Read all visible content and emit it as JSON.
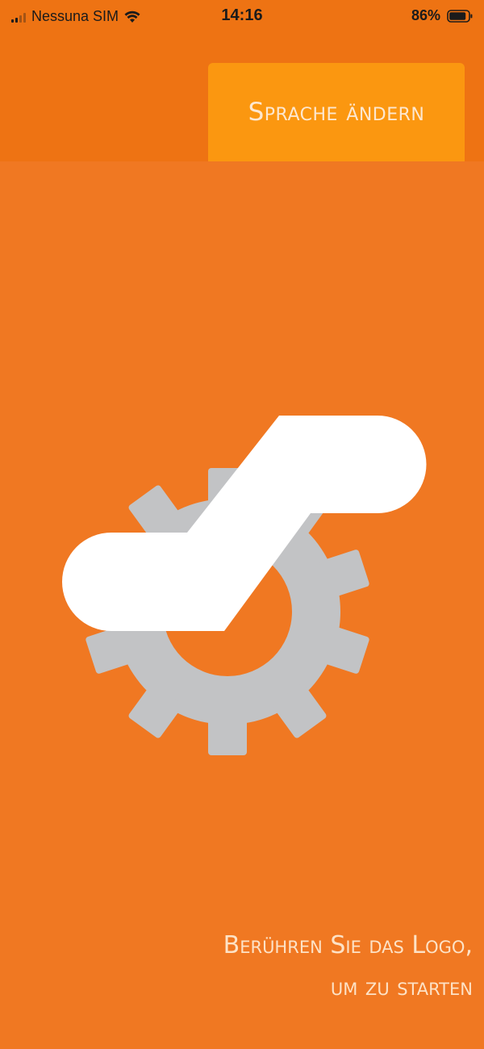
{
  "status_bar": {
    "carrier": "Nessuna SIM",
    "time": "14:16",
    "battery": "86%",
    "icons": [
      "signal-icon",
      "wifi-icon",
      "battery-icon"
    ]
  },
  "header": {
    "change_language_label": "Sprache ändern"
  },
  "logo": {
    "icon": "gear-logo-icon"
  },
  "hint": {
    "line1": "Berühren Sie das Logo,",
    "line2": "um zu starten"
  },
  "colors": {
    "background": "#f07822",
    "header_background": "#ee7313",
    "button_background": "#fb9710",
    "gear": "#c2c3c5",
    "logo_white": "#ffffff"
  }
}
